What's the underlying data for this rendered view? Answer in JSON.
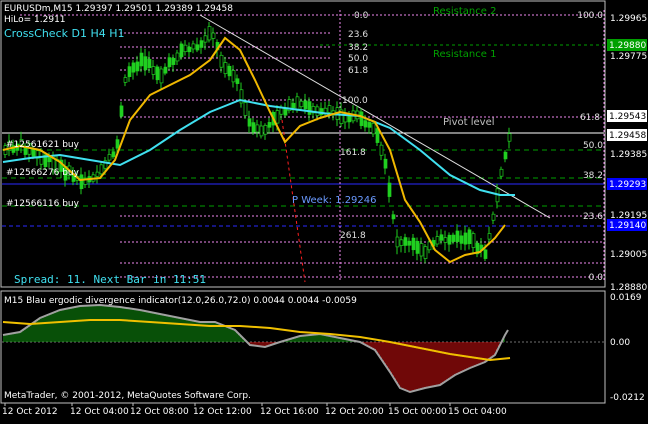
{
  "chart_header": {
    "symbol_line": "EURUSDm,M15  1.29397 1.29501 1.29389 1.29458",
    "hilo_line": "HiLo= 1.2911",
    "crosscheck": "CrossCheck  D1  H4  H1"
  },
  "price_axis": {
    "labels": [
      "1.29965",
      "1.29775",
      "1.29385",
      "1.29195",
      "1.29005",
      "1.28880"
    ],
    "highlighted": [
      "1.29880",
      "1.29543",
      "1.29458",
      "1.29293",
      "1.29140"
    ],
    "colors": {
      "green": "#00a000",
      "white": "#ffffff",
      "blue": "#0000ff"
    }
  },
  "levels": {
    "resistance2": "Resistance 2",
    "resistance1": "Resistance 1",
    "pivot": "Pivot level",
    "pweek": "P Week: 1.29246",
    "fib_left": [
      "0.0",
      "23.6",
      "38.2",
      "50.0",
      "61.8",
      "100.0",
      "161.8",
      "261.8"
    ],
    "fib_right": [
      "100.0",
      "61.8",
      "50.0",
      "38.2",
      "23.6",
      "0.0"
    ]
  },
  "orders": [
    "#12561621 buy",
    "#12566276 buy",
    "#12566116 buy"
  ],
  "spread_text": "Spread: 11. Next Bar in 11:51",
  "indicator": {
    "title": "M15 Blau ergodic divergence indicator(12.0,26.0,72.0) 0.0044 0.0044 -0.0059",
    "axis": [
      "0.0169",
      "0.00",
      "-0.0212"
    ]
  },
  "copyright": "MetaTrader, © 2001-2012, MetaQuotes Software Corp.",
  "time_axis": [
    "12 Oct 2012",
    "12 Oct 04:00",
    "12 Oct 08:00",
    "12 Oct 12:00",
    "12 Oct 16:00",
    "12 Oct 20:00",
    "15 Oct 00:00",
    "15 Oct 04:00"
  ]
}
